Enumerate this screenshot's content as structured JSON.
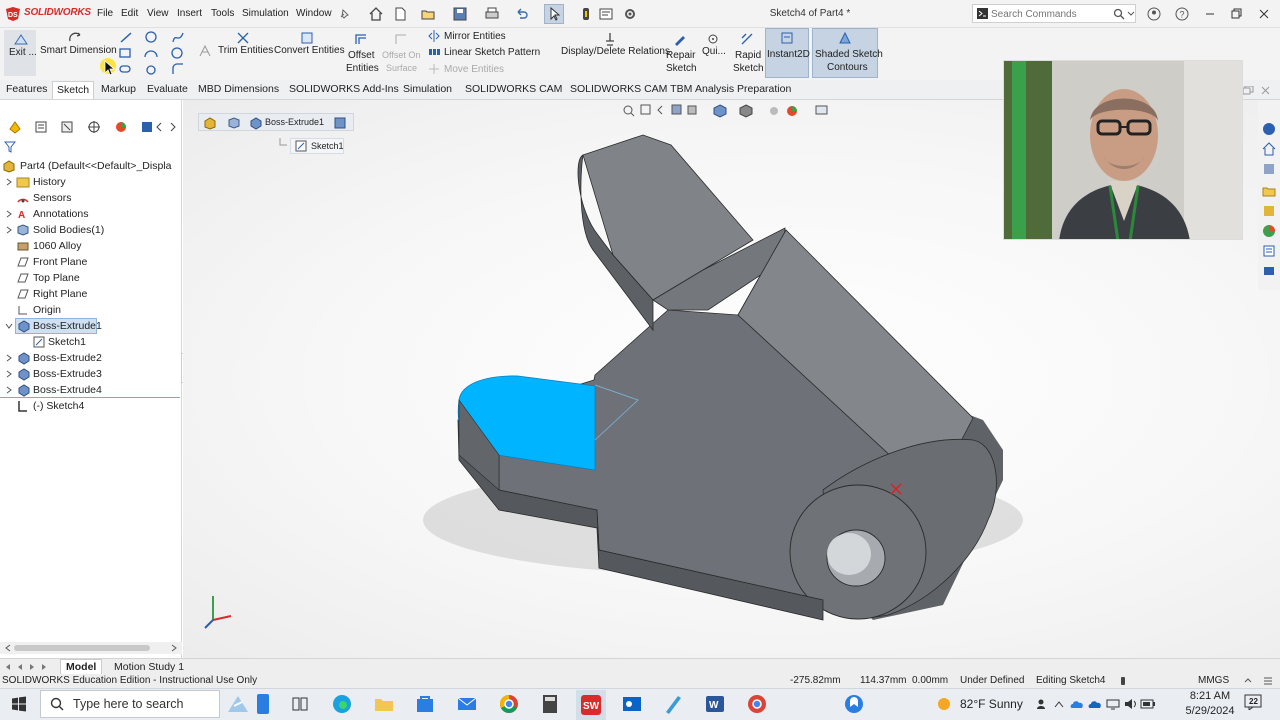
{
  "app": {
    "logo_text": "SOLIDWORKS",
    "window_title": "Sketch4 of Part4 *",
    "menu": [
      "File",
      "Edit",
      "View",
      "Insert",
      "Tools",
      "Simulation",
      "Window"
    ],
    "search_placeholder": "Search Commands"
  },
  "ribbon": {
    "exit_sketch": "Exit ...",
    "smart_dimension": "Smart Dimension",
    "trim_entities": "Trim Entities",
    "convert_entities": "Convert Entities",
    "offset_entities_1": "Offset",
    "offset_entities_2": "Entities",
    "offset_surface_1": "Offset On",
    "offset_surface_2": "Surface",
    "mirror_entities": "Mirror Entities",
    "linear_pattern": "Linear Sketch Pattern",
    "move_entities": "Move Entities",
    "display_relations": "Display/Delete Relations",
    "repair_sketch_1": "Repair",
    "repair_sketch_2": "Sketch",
    "quick_snaps": "Qui...",
    "rapid_sketch_1": "Rapid",
    "rapid_sketch_2": "Sketch",
    "instant2d": "Instant2D",
    "shaded_contours_1": "Shaded Sketch",
    "shaded_contours_2": "Contours"
  },
  "tabs": [
    "Features",
    "Sketch",
    "Markup",
    "Evaluate",
    "MBD Dimensions",
    "SOLIDWORKS Add-Ins",
    "Simulation",
    "SOLIDWORKS CAM",
    "SOLIDWORKS CAM TBM",
    "Analysis Preparation"
  ],
  "active_tab": "Sketch",
  "tree": {
    "root": "Part4  (Default<<Default>_Displa",
    "items": [
      {
        "label": "History"
      },
      {
        "label": "Sensors"
      },
      {
        "label": "Annotations"
      },
      {
        "label": "Solid Bodies(1)"
      },
      {
        "label": "1060 Alloy"
      },
      {
        "label": "Front Plane"
      },
      {
        "label": "Top Plane"
      },
      {
        "label": "Right Plane"
      },
      {
        "label": "Origin"
      },
      {
        "label": "Boss-Extrude1"
      },
      {
        "label": "Sketch1"
      },
      {
        "label": "Boss-Extrude2"
      },
      {
        "label": "Boss-Extrude3"
      },
      {
        "label": "Boss-Extrude4"
      },
      {
        "label": "(-) Sketch4"
      }
    ]
  },
  "breadcrumb": {
    "item1": "Boss-Extrude1",
    "item2": "Sketch1"
  },
  "bottom_tabs": [
    "Model",
    "Motion Study 1"
  ],
  "status": {
    "edition": "SOLIDWORKS Education Edition - Instructional Use Only",
    "x": "-275.82mm",
    "y": "114.37mm",
    "z": "0.00mm",
    "state": "Under Defined",
    "editing": "Editing Sketch4",
    "units": "MMGS"
  },
  "taskbar": {
    "search_placeholder": "Type here to search",
    "weather": "82°F  Sunny",
    "time": "8:21 AM",
    "date": "5/29/2024",
    "notif_count": "22"
  },
  "colors": {
    "selected_face": "#00b4ff",
    "model_gray": "#6e7278",
    "logo_red": "#d82c2a"
  }
}
